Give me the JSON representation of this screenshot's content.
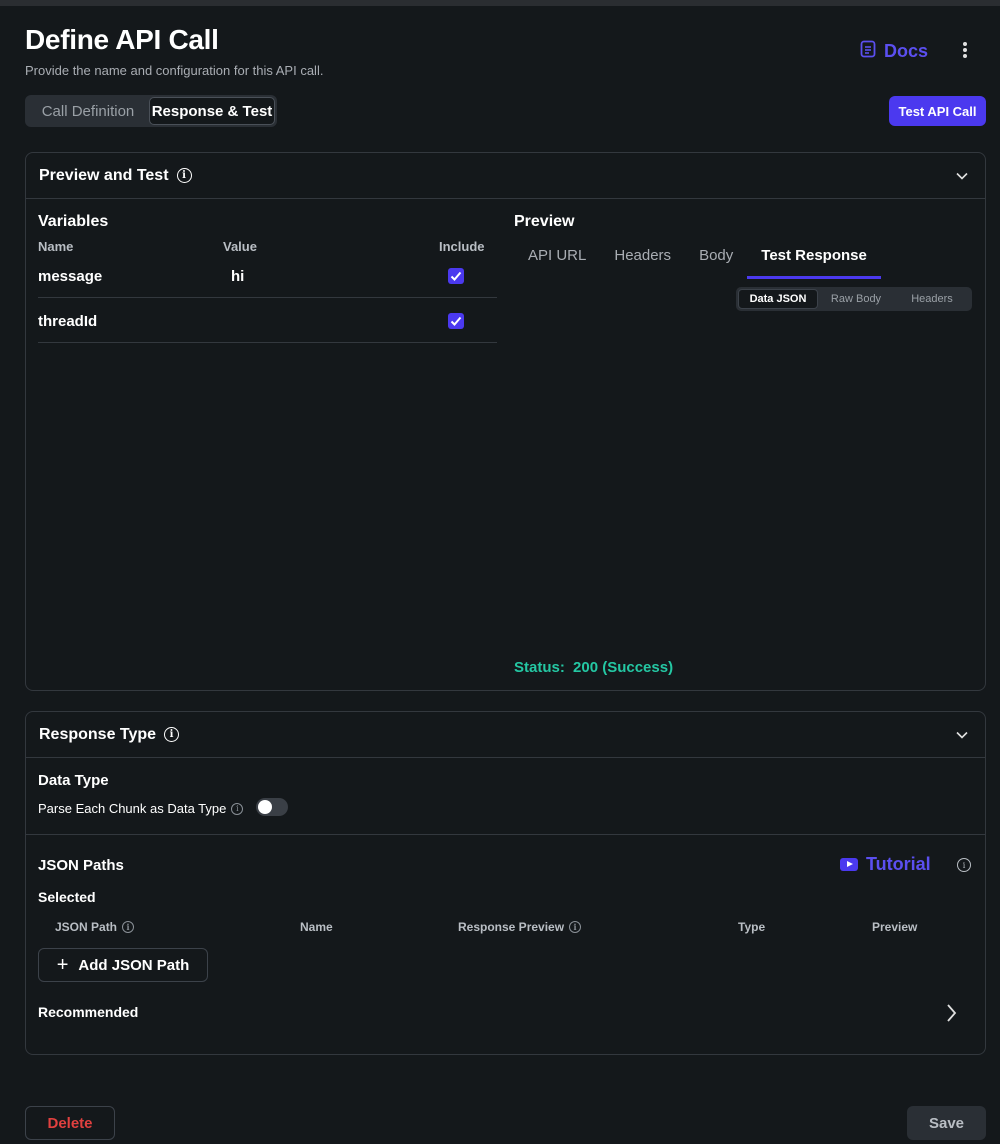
{
  "header": {
    "title": "Define API Call",
    "subtitle": "Provide the name and configuration for this API call.",
    "docs_label": "Docs"
  },
  "tabs": {
    "call_definition": "Call Definition",
    "response_test": "Response & Test",
    "active": "Response & Test"
  },
  "actions": {
    "test_api_call": "Test API Call",
    "delete": "Delete",
    "save": "Save"
  },
  "preview_test": {
    "title": "Preview and Test",
    "variables": {
      "title": "Variables",
      "columns": [
        "Name",
        "Value",
        "Include"
      ],
      "rows": [
        {
          "name": "message",
          "value": "hi",
          "include": true
        },
        {
          "name": "threadId",
          "value": "",
          "include": true
        }
      ]
    },
    "preview": {
      "title": "Preview",
      "tabs": [
        "API URL",
        "Headers",
        "Body",
        "Test Response"
      ],
      "active_tab": "Test Response",
      "sub_tabs": [
        "Data JSON",
        "Raw Body",
        "Headers"
      ],
      "active_sub_tab": "Data JSON",
      "status_label": "Status:",
      "status_value": "200 (Success)"
    }
  },
  "response_type": {
    "title": "Response Type",
    "data_type": {
      "title": "Data Type",
      "parse_label": "Parse Each Chunk as Data Type",
      "parse_enabled": false
    },
    "json_paths": {
      "title": "JSON Paths",
      "tutorial_label": "Tutorial",
      "selected_label": "Selected",
      "columns": [
        "JSON Path",
        "Name",
        "Response Preview",
        "Type",
        "Preview"
      ],
      "add_label": "Add JSON Path",
      "recommended_label": "Recommended"
    }
  },
  "colors": {
    "accent": "#4b39ef",
    "success": "#24c7a3",
    "danger": "#e0403f",
    "background": "#14181b"
  }
}
